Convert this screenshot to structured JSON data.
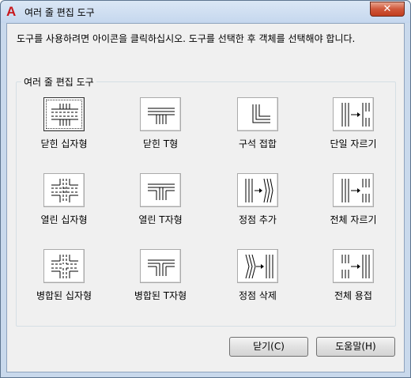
{
  "window": {
    "title": "여러 줄 편집 도구",
    "close_glyph": "✕"
  },
  "instruction": "도구를 사용하려면 아이콘을 클릭하십시오. 도구를 선택한 후 객체를 선택해야 합니다.",
  "group": {
    "label": "여러 줄 편집 도구"
  },
  "tools": [
    {
      "label": "닫힌 십자형",
      "icon": "closed-cross-icon"
    },
    {
      "label": "닫힌 T형",
      "icon": "closed-tee-icon"
    },
    {
      "label": "구석 접합",
      "icon": "corner-joint-icon"
    },
    {
      "label": "단일 자르기",
      "icon": "cut-single-icon"
    },
    {
      "label": "열린 십자형",
      "icon": "open-cross-icon"
    },
    {
      "label": "열린 T자형",
      "icon": "open-tee-icon"
    },
    {
      "label": "정점 추가",
      "icon": "add-vertex-icon"
    },
    {
      "label": "전체 자르기",
      "icon": "cut-all-icon"
    },
    {
      "label": "병합된 십자형",
      "icon": "merged-cross-icon"
    },
    {
      "label": "병합된 T자형",
      "icon": "merged-tee-icon"
    },
    {
      "label": "정점 삭제",
      "icon": "delete-vertex-icon"
    },
    {
      "label": "전체 용접",
      "icon": "weld-all-icon"
    }
  ],
  "buttons": {
    "close": "닫기(C)",
    "help": "도움말(H)"
  }
}
